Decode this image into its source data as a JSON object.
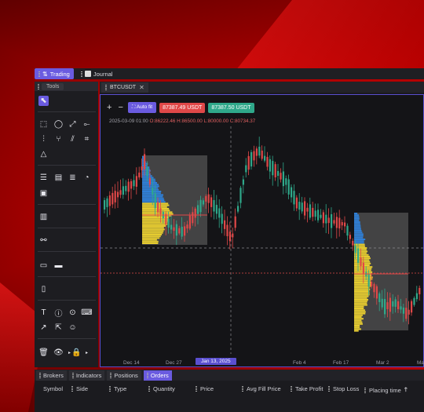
{
  "top_tabs": [
    {
      "label": "Trading",
      "active": true
    },
    {
      "label": "Journal",
      "active": false
    }
  ],
  "tools_panel": {
    "tab_label": "Tools"
  },
  "chart": {
    "tab_label": "BTCUSDT",
    "zoom_in": "+",
    "zoom_out": "−",
    "autofit_label": "Auto fit",
    "bid_price": "87387.49 USDT",
    "ask_price": "87387.50 USDT",
    "ohlc_date": "2025-03-09 01:00",
    "ohlc_o": "O:86222.46",
    "ohlc_h": "H:86500.00",
    "ohlc_l": "L:80000.00",
    "ohlc_c": "C:80734.37",
    "x_labels": [
      "Dec 14",
      "Dec 27",
      "Jan 13, 2025",
      "Feb 4",
      "Feb 17",
      "Mar 2",
      "Ma"
    ],
    "colors": {
      "up": "#2fa88a",
      "down": "#e04848",
      "accent": "#6a5be0",
      "profile_blue": "#2f7fd6",
      "profile_yellow": "#e6cc30"
    }
  },
  "bottom_tabs": [
    {
      "label": "Brokers",
      "active": false
    },
    {
      "label": "Indicators",
      "active": false
    },
    {
      "label": "Positions",
      "active": false
    },
    {
      "label": "Orders",
      "active": true
    }
  ],
  "orders_columns": [
    "Symbol",
    "Side",
    "Type",
    "Quantity",
    "Price",
    "Avg Fill Price",
    "Take Profit",
    "Stop Loss",
    "Placing time"
  ]
}
